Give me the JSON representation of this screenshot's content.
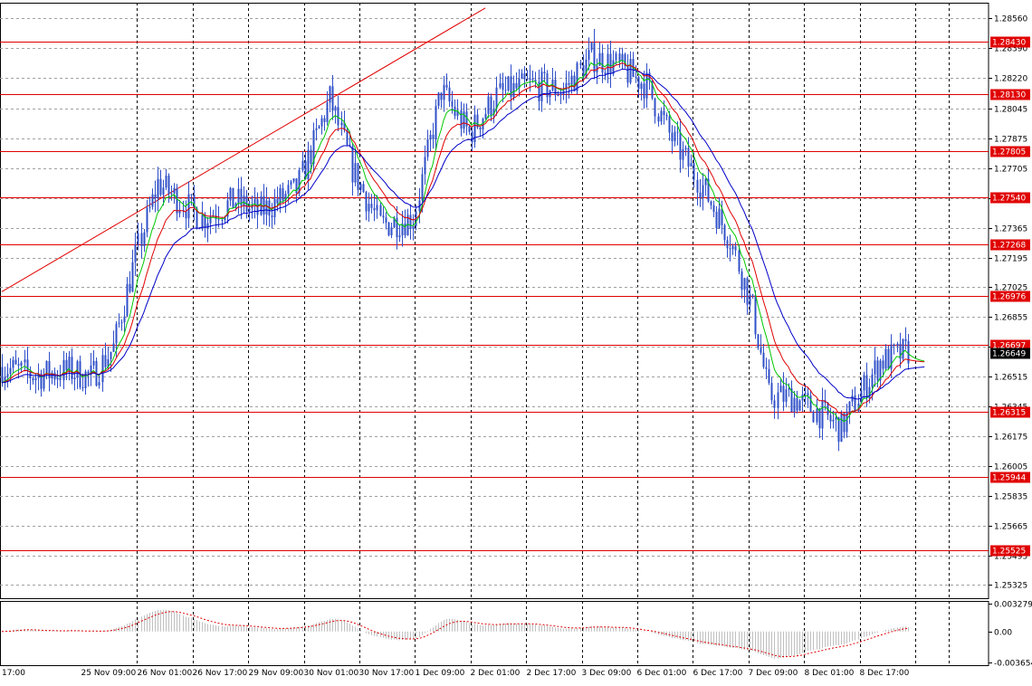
{
  "chart_data": {
    "type": "candlestick",
    "instrument_hint": "GBP/USD H1",
    "main": {
      "ylim": [
        1.2525,
        1.2865
      ],
      "y_tick_labels": [
        "1.28560",
        "1.28390",
        "1.28220",
        "1.28045",
        "1.27875",
        "1.27705",
        "1.27535",
        "1.27365",
        "1.27195",
        "1.27025",
        "1.26855",
        "1.26685",
        "1.26515",
        "1.26345",
        "1.26175",
        "1.26005",
        "1.25835",
        "1.25665",
        "1.25495",
        "1.25325"
      ],
      "y_tick_values": [
        1.2856,
        1.2839,
        1.2822,
        1.28045,
        1.27875,
        1.27705,
        1.27535,
        1.27365,
        1.27195,
        1.27025,
        1.26855,
        1.26685,
        1.26515,
        1.26345,
        1.26175,
        1.26005,
        1.25835,
        1.25665,
        1.25495,
        1.25325
      ],
      "current_price": "1.26649",
      "current_price_value": 1.26649,
      "levels": [
        {
          "label": "1.28430",
          "value": 1.2843
        },
        {
          "label": "1.28130",
          "value": 1.2813
        },
        {
          "label": "1.27805",
          "value": 1.27805
        },
        {
          "label": "1.27540",
          "value": 1.2754
        },
        {
          "label": "1.27268",
          "value": 1.27268
        },
        {
          "label": "1.26976",
          "value": 1.26976
        },
        {
          "label": "1.26697",
          "value": 1.26697
        },
        {
          "label": "1.26315",
          "value": 1.26315
        },
        {
          "label": "1.25944",
          "value": 1.25944
        },
        {
          "label": "1.25525",
          "value": 1.25525
        }
      ],
      "trendline": {
        "from": {
          "bar": 0,
          "price": 1.27
        },
        "to": {
          "bar": 174,
          "price": 1.2862
        }
      },
      "anchors": [
        [
          0,
          1.2657
        ],
        [
          12,
          1.2652
        ],
        [
          24,
          1.2655
        ],
        [
          32,
          1.2651
        ],
        [
          40,
          1.2668
        ],
        [
          48,
          1.272
        ],
        [
          56,
          1.2762
        ],
        [
          64,
          1.2752
        ],
        [
          72,
          1.2742
        ],
        [
          84,
          1.2752
        ],
        [
          92,
          1.2745
        ],
        [
          106,
          1.2758
        ],
        [
          118,
          1.281
        ],
        [
          126,
          1.277
        ],
        [
          136,
          1.2738
        ],
        [
          148,
          1.2742
        ],
        [
          158,
          1.2815
        ],
        [
          168,
          1.279
        ],
        [
          178,
          1.2812
        ],
        [
          190,
          1.2818
        ],
        [
          202,
          1.2815
        ],
        [
          212,
          1.2834
        ],
        [
          220,
          1.283
        ],
        [
          232,
          1.2818
        ],
        [
          240,
          1.279
        ],
        [
          252,
          1.276
        ],
        [
          262,
          1.273
        ],
        [
          270,
          1.269
        ],
        [
          276,
          1.264
        ],
        [
          284,
          1.264
        ],
        [
          292,
          1.2633
        ],
        [
          302,
          1.2622
        ],
        [
          308,
          1.264
        ],
        [
          316,
          1.266
        ],
        [
          326,
          1.2666
        ]
      ],
      "bar_count": 327
    },
    "moving_averages": [
      {
        "period": 8,
        "color": "#00c800"
      },
      {
        "period": 14,
        "color": "#e00000"
      },
      {
        "period": 26,
        "color": "#0000c8"
      }
    ],
    "oscillator": {
      "tick_labels": [
        "0.003279",
        "0.00",
        "-0.003654"
      ],
      "tick_values": [
        0.003279,
        0.0,
        -0.003654
      ]
    },
    "x_tick_labels": [
      "17:00",
      "25 Nov 09:00",
      "26 Nov 01:00",
      "26 Nov 17:00",
      "29 Nov 09:00",
      "30 Nov 01:00",
      "30 Nov 17:00",
      "1 Dec 09:00",
      "2 Dec 01:00",
      "2 Dec 17:00",
      "3 Dec 09:00",
      "6 Dec 01:00",
      "6 Dec 17:00",
      "7 Dec 09:00",
      "8 Dec 01:00",
      "8 Dec 17:00"
    ],
    "x_tick_bars": [
      0,
      20,
      40,
      60,
      80,
      100,
      120,
      140,
      160,
      180,
      200,
      220,
      240,
      260,
      280,
      300
    ],
    "colors": {
      "candle": "#3050c8",
      "level_line": "#e00000",
      "level_label_bg": "#e00000",
      "price_label_bg": "#000000",
      "grid": "#000000",
      "histogram": "#c0c0c0",
      "signal": "#e00000"
    }
  }
}
